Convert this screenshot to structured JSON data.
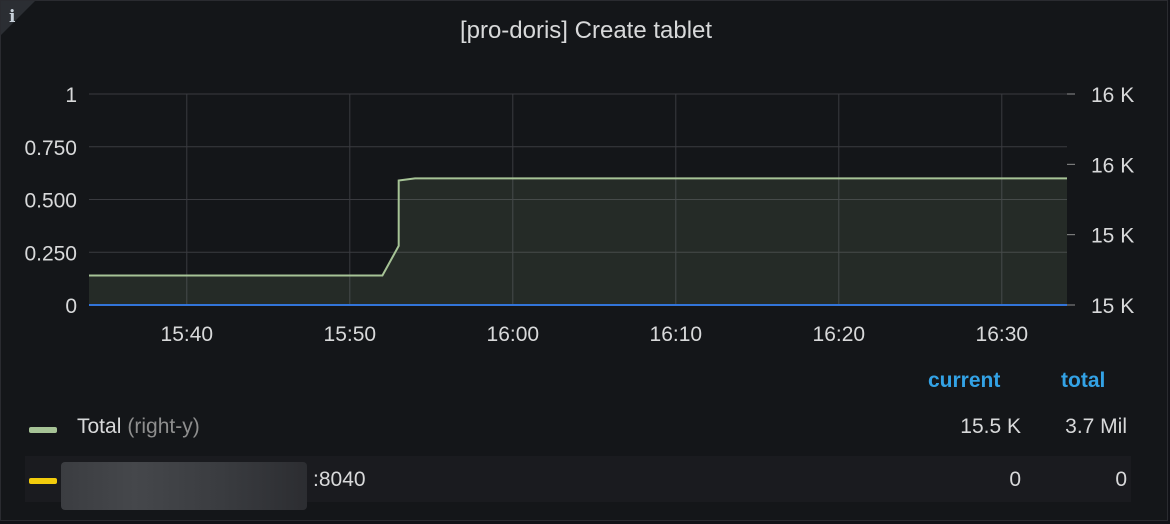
{
  "panel": {
    "title": "[pro-doris] Create tablet",
    "info_icon": "info-icon"
  },
  "chart_data": {
    "type": "area",
    "title": "[pro-doris] Create tablet",
    "x_ticks": [
      "15:40",
      "15:50",
      "16:00",
      "16:10",
      "16:20",
      "16:30"
    ],
    "x_range": [
      "15:34",
      "16:34"
    ],
    "y_left": {
      "ticks": [
        "1",
        "0.750",
        "0.500",
        "0.250",
        "0"
      ],
      "range": [
        0,
        1
      ]
    },
    "y_right": {
      "ticks": [
        "16 K",
        "16 K",
        "15 K",
        "15 K"
      ],
      "range": [
        15300,
        15800
      ]
    },
    "grid": true,
    "legend_placement": "bottom",
    "series": [
      {
        "name": "Total",
        "axis": "right-y",
        "color": "#a6c396",
        "points": [
          [
            "15:34",
            15370
          ],
          [
            "15:52",
            15370
          ],
          [
            "15:53",
            15440
          ],
          [
            "15:53",
            15595
          ],
          [
            "15:54",
            15600
          ],
          [
            "16:34",
            15600
          ]
        ]
      },
      {
        "name": ":8040",
        "axis": "left-y",
        "color": "#3274d9",
        "points": [
          [
            "15:34",
            0
          ],
          [
            "16:34",
            0
          ]
        ]
      }
    ]
  },
  "legend": {
    "headers": {
      "current": "current",
      "total": "total"
    },
    "rows": [
      {
        "name": "Total",
        "suffix": "(right-y)",
        "color": "#a6c396",
        "current": "15.5 K",
        "total": "3.7 Mil"
      },
      {
        "name": ":8040",
        "suffix": "",
        "color": "#f2cc0c",
        "current": "0",
        "total": "0"
      }
    ]
  }
}
